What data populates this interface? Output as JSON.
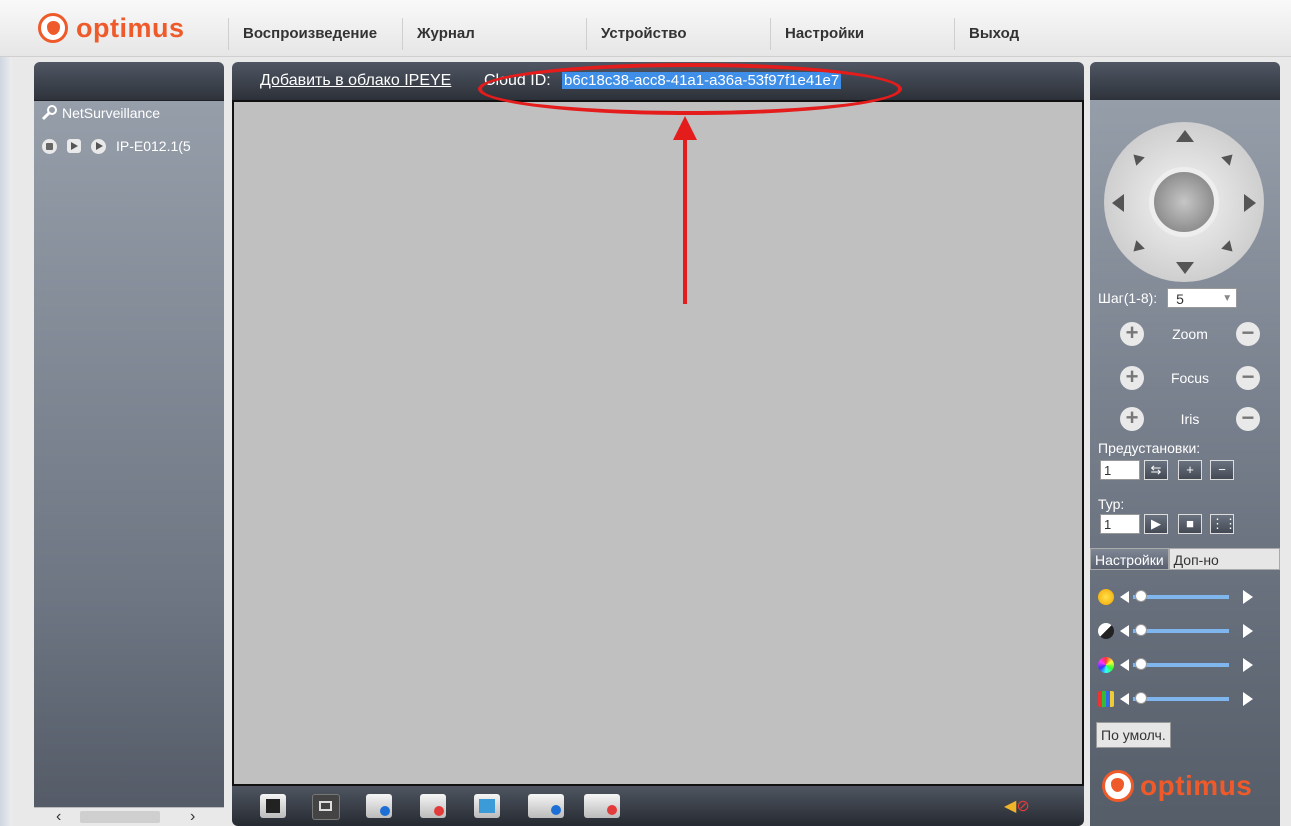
{
  "app": {
    "logo_text": "optimus"
  },
  "menu": {
    "items": [
      {
        "label": "Воспроизведение"
      },
      {
        "label": "Журнал"
      },
      {
        "label": "Устройство"
      },
      {
        "label": "Настройки"
      },
      {
        "label": "Выход"
      }
    ]
  },
  "sidebar": {
    "root_label": "NetSurveillance",
    "device_label": "IP-E012.1(5"
  },
  "video": {
    "add_cloud_link": "Добавить в облако IPEYE",
    "cloud_label": "Cloud ID:",
    "cloud_id": "b6c18c38-acc8-41a1-a36a-53f97f1e41e7"
  },
  "ptz": {
    "step_label": "Шаг(1-8):",
    "step_value": "5",
    "zoom_label": "Zoom",
    "focus_label": "Focus",
    "iris_label": "Iris",
    "presets_label": "Предустановки:",
    "preset_value": "1",
    "tour_label": "Тур:",
    "tour_value": "1"
  },
  "image_tabs": {
    "settings": "Настройки",
    "extra": "Доп-но"
  },
  "default_button": "По умолч.",
  "colors": {
    "accent": "#ef5a2a",
    "annotation": "#e41c1c",
    "selection": "#3f8fe8"
  }
}
